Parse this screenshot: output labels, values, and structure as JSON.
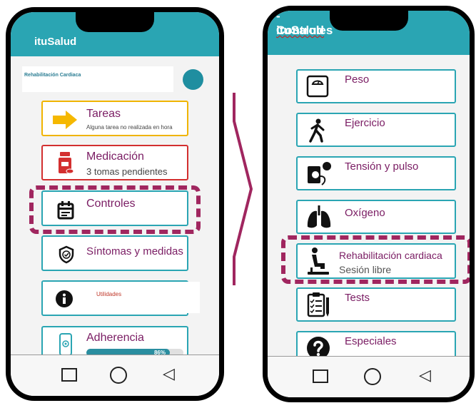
{
  "left": {
    "app_title": "ituSalud",
    "profile_label": "Rehabilitación Cardiaca",
    "cards": [
      {
        "title": "Tareas",
        "sub": "Alguna tarea no realizada en hora"
      },
      {
        "title": "Medicación",
        "sub": "3 tomas pendientes"
      },
      {
        "title": "Controles",
        "sub": ""
      },
      {
        "title": "Síntomas y medidas",
        "sub": ""
      },
      {
        "title": "Utilidades",
        "sub": ""
      },
      {
        "title": "Adherencia",
        "sub": ""
      }
    ],
    "adherence_percent_label": "86%",
    "adherence_value": 0.86
  },
  "right": {
    "app_title_brand": "ituSalud",
    "app_title_rest": " - Controles",
    "cards": [
      {
        "title": "Peso",
        "sub": ""
      },
      {
        "title": "Ejercicio",
        "sub": ""
      },
      {
        "title": "Tensión y pulso",
        "sub": ""
      },
      {
        "title": "Oxígeno",
        "sub": ""
      },
      {
        "title": "Rehabilitación cardiaca",
        "sub": "Sesión libre"
      },
      {
        "title": "Tests",
        "sub": ""
      },
      {
        "title": "Especiales",
        "sub": ""
      }
    ]
  },
  "colors": {
    "header": "#2aa5b3",
    "card_border": "#2aa5b3",
    "tareas_border": "#f0b400",
    "medicacion_border": "#d32f2f",
    "title_text": "#7a1c63",
    "highlight_dash": "#a0265f",
    "progress_fill": "#2a8ea0"
  },
  "icons": {
    "tareas": "arrow-right-icon",
    "medicacion": "pill-bottle-icon",
    "controles": "calendar-icon",
    "sintomas": "shield-check-icon",
    "utilidades": "info-icon",
    "adherencia": "phone-touch-icon",
    "peso": "scale-icon",
    "ejercicio": "walking-icon",
    "tension": "blood-pressure-icon",
    "oxigeno": "lungs-icon",
    "rehab": "cycling-person-icon",
    "tests": "clipboard-icon",
    "especiales": "question-icon"
  }
}
